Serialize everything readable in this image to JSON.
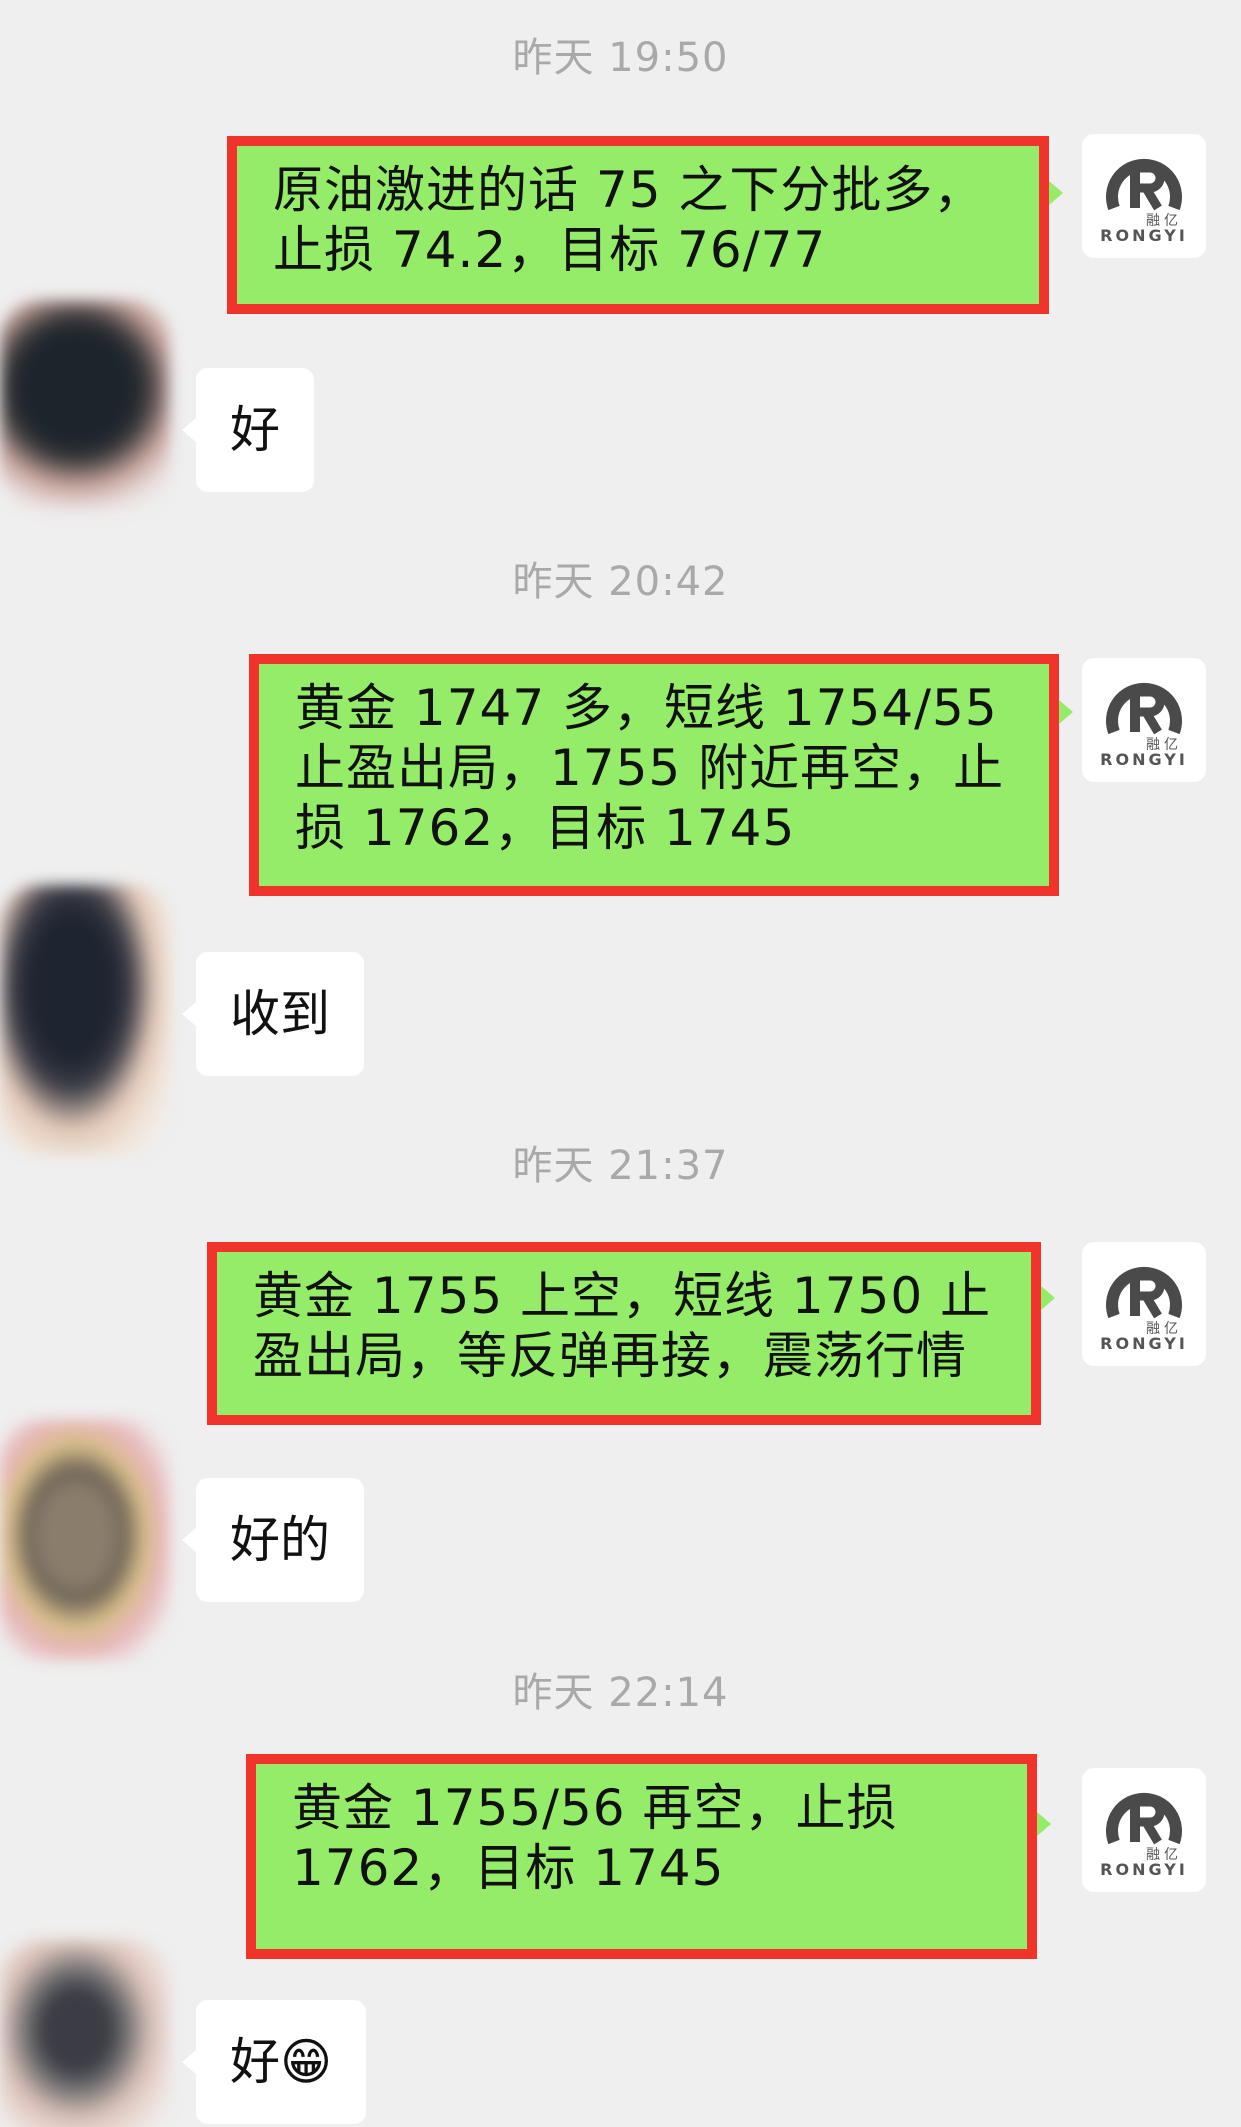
{
  "conversation": [
    {
      "time": "昨天 19:50",
      "outgoing": "原油激进的话 75 之下分批多，止损 74.2，目标 76/77",
      "reply": "好"
    },
    {
      "time": "昨天 20:42",
      "outgoing": "黄金 1747 多，短线 1754/55 止盈出局，1755 附近再空，止损 1762，目标 1745",
      "reply": "收到"
    },
    {
      "time": "昨天 21:37",
      "outgoing": "黄金 1755 上空，短线 1750 止盈出局，等反弹再接，震荡行情",
      "reply": "好的"
    },
    {
      "time": "昨天 22:14",
      "outgoing": "黄金 1755/56 再空，止损 1762，目标 1745",
      "reply": "好😁"
    }
  ],
  "sender_logo": {
    "icon": "rongyi-logo-icon",
    "brand": "RONGYI",
    "brand_cn": "融亿"
  },
  "colors": {
    "background": "#efefef",
    "outgoing_bubble": "#95ec69",
    "highlight_frame": "#f0332b",
    "incoming_bubble": "#ffffff",
    "timestamp": "#a9a9a9"
  }
}
